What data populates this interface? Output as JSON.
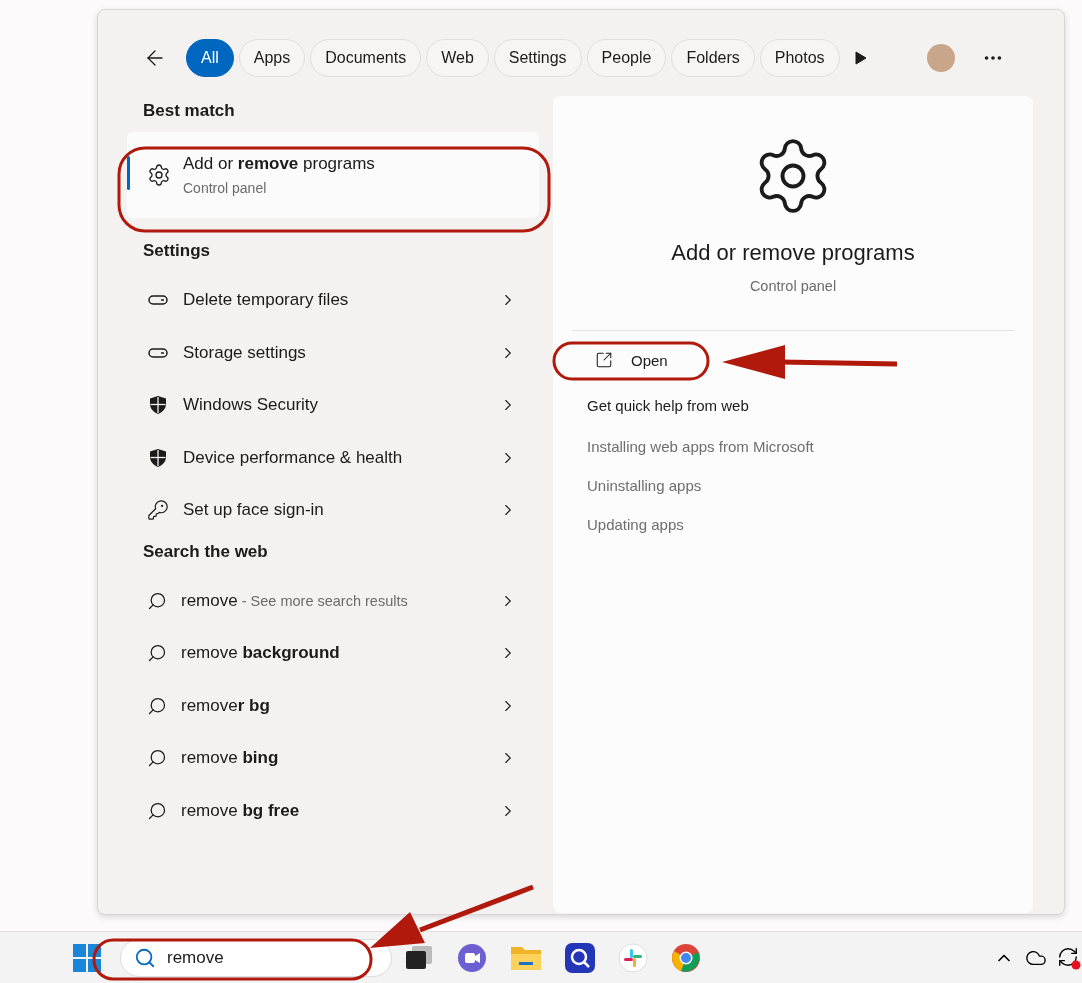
{
  "tabs": [
    {
      "label": "All",
      "selected": true
    },
    {
      "label": "Apps",
      "selected": false
    },
    {
      "label": "Documents",
      "selected": false
    },
    {
      "label": "Web",
      "selected": false
    },
    {
      "label": "Settings",
      "selected": false
    },
    {
      "label": "People",
      "selected": false
    },
    {
      "label": "Folders",
      "selected": false
    },
    {
      "label": "Photos",
      "selected": false
    }
  ],
  "best_match": {
    "heading": "Best match",
    "title": "Add or **remove** programs",
    "subtitle": "Control panel",
    "selected": true
  },
  "settings": {
    "heading": "Settings",
    "items": [
      {
        "kind": "drive",
        "label": "Delete temporary files"
      },
      {
        "kind": "drive",
        "label": "Storage settings"
      },
      {
        "kind": "shield",
        "label": "Windows Security"
      },
      {
        "kind": "shield",
        "label": "Device performance & health"
      },
      {
        "kind": "key",
        "label": "Set up face sign-in"
      }
    ]
  },
  "web": {
    "heading": "Search the web",
    "items": [
      {
        "query": "remove",
        "hint": "- See more search results"
      },
      {
        "query": "remove **background**"
      },
      {
        "query": "remove**r bg**"
      },
      {
        "query": "remove **bing**"
      },
      {
        "query": "remove **bg free**"
      }
    ]
  },
  "preview": {
    "title": "Add or remove programs",
    "subtitle": "Control panel",
    "open_label": "Open",
    "help_heading": "Get quick help from web",
    "links": [
      "Installing web apps from Microsoft",
      "Uninstalling apps",
      "Updating apps"
    ]
  },
  "taskbar": {
    "search_value": "remove"
  }
}
